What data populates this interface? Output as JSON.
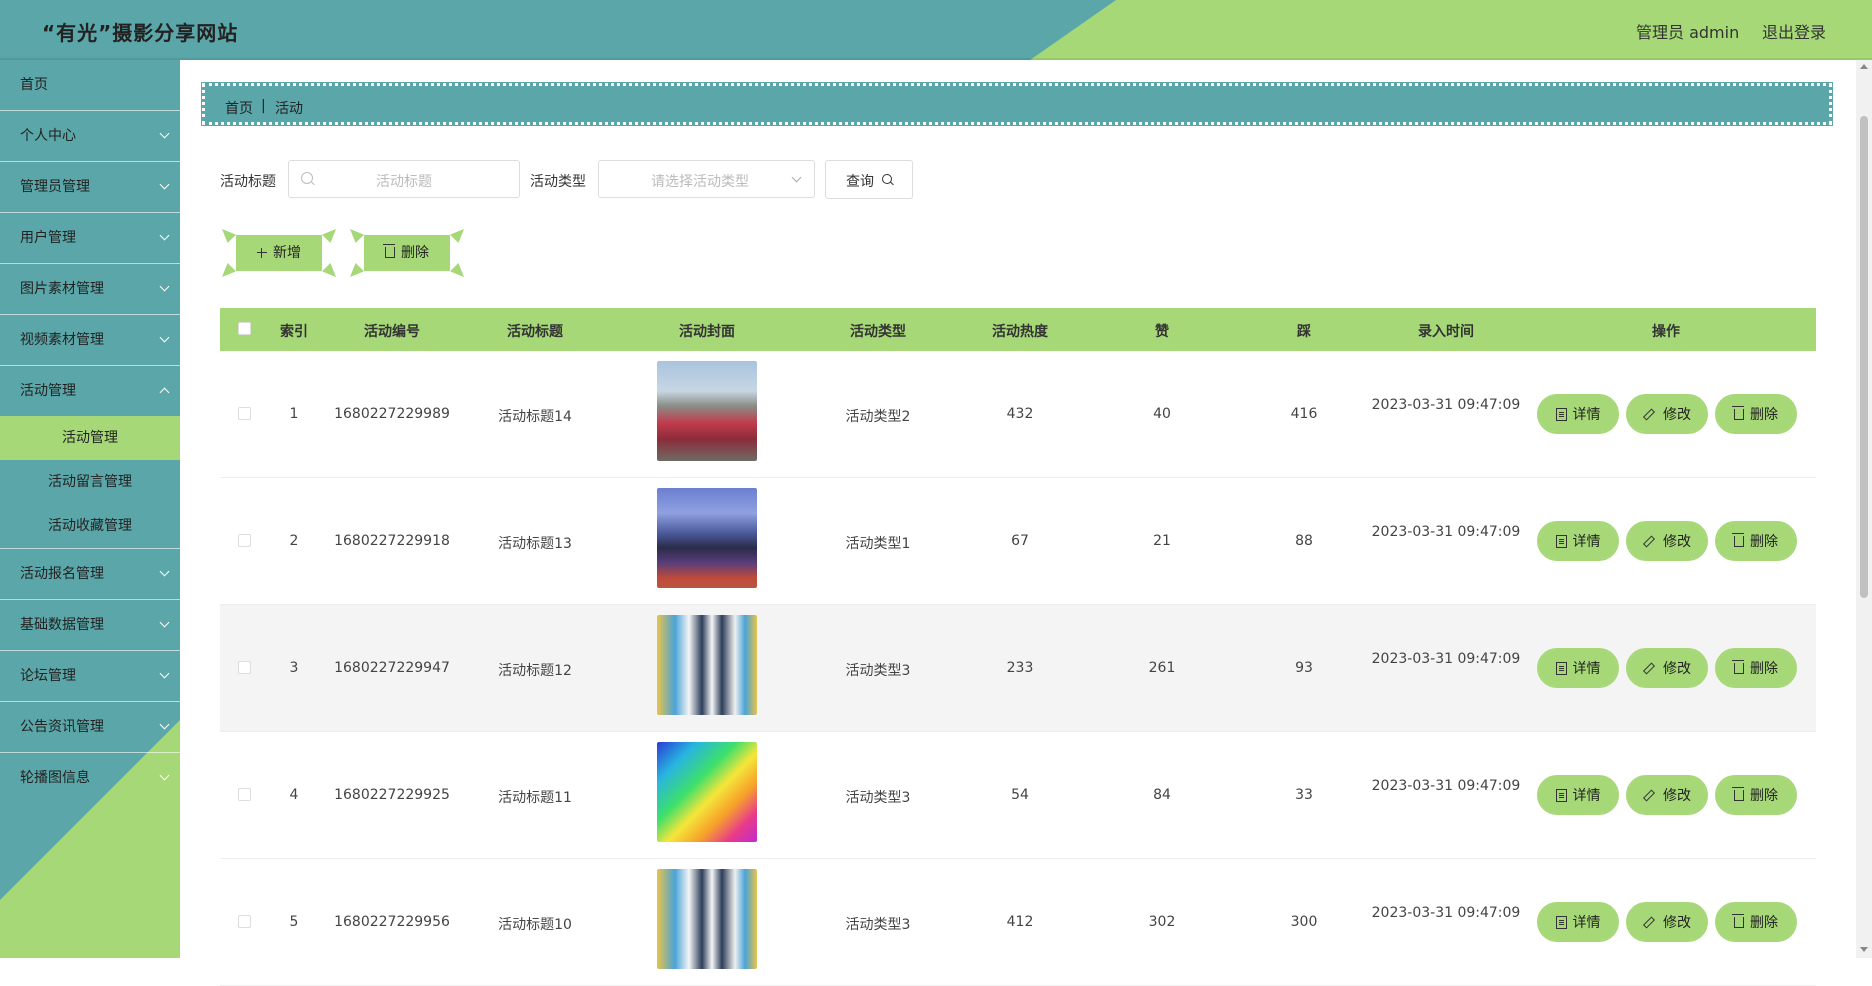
{
  "app": {
    "title": "“有光”摄影分享网站",
    "admin_label": "管理员 admin",
    "logout_label": "退出登录"
  },
  "colors": {
    "teal": "#5ba6a8",
    "green": "#a6d878"
  },
  "sidebar": {
    "items": [
      {
        "label": "首页"
      },
      {
        "label": "个人中心"
      },
      {
        "label": "管理员管理"
      },
      {
        "label": "用户管理"
      },
      {
        "label": "图片素材管理"
      },
      {
        "label": "视频素材管理"
      },
      {
        "label": "活动管理",
        "open": true,
        "children": [
          {
            "label": "活动管理",
            "active": true
          },
          {
            "label": "活动留言管理"
          },
          {
            "label": "活动收藏管理"
          }
        ]
      },
      {
        "label": "活动报名管理"
      },
      {
        "label": "基础数据管理"
      },
      {
        "label": "论坛管理"
      },
      {
        "label": "公告资讯管理"
      },
      {
        "label": "轮播图信息"
      }
    ]
  },
  "breadcrumb": {
    "home": "首页",
    "separator": "|",
    "current": "活动"
  },
  "search": {
    "title_label": "活动标题",
    "title_placeholder": "活动标题",
    "type_label": "活动类型",
    "type_placeholder": "请选择活动类型",
    "query_button": "查询"
  },
  "actions": {
    "add_label": "新增",
    "delete_label": "删除"
  },
  "table": {
    "headers": [
      "索引",
      "活动编号",
      "活动标题",
      "活动封面",
      "活动类型",
      "活动热度",
      "赞",
      "踩",
      "录入时间",
      "操作"
    ],
    "row_buttons": {
      "detail": "详情",
      "edit": "修改",
      "delete": "删除"
    },
    "rows": [
      {
        "index": "1",
        "code": "1680227229989",
        "title": "活动标题14",
        "cover": "crowd-photo",
        "type": "活动类型2",
        "heat": "432",
        "like": "40",
        "dislike": "416",
        "time": "2023-03-31 09:47:09"
      },
      {
        "index": "2",
        "code": "1680227229918",
        "title": "活动标题13",
        "cover": "stadium-photo",
        "type": "活动类型1",
        "heat": "67",
        "like": "21",
        "dislike": "88",
        "time": "2023-03-31 09:47:09"
      },
      {
        "index": "3",
        "code": "1680227229947",
        "title": "活动标题12",
        "cover": "group-photo",
        "type": "活动类型3",
        "heat": "233",
        "like": "261",
        "dislike": "93",
        "time": "2023-03-31 09:47:09"
      },
      {
        "index": "4",
        "code": "1680227229925",
        "title": "活动标题11",
        "cover": "colorful-poster",
        "type": "活动类型3",
        "heat": "54",
        "like": "84",
        "dislike": "33",
        "time": "2023-03-31 09:47:09"
      },
      {
        "index": "5",
        "code": "1680227229956",
        "title": "活动标题10",
        "cover": "group-photo",
        "type": "活动类型3",
        "heat": "412",
        "like": "302",
        "dislike": "300",
        "time": "2023-03-31 09:47:09"
      }
    ]
  }
}
